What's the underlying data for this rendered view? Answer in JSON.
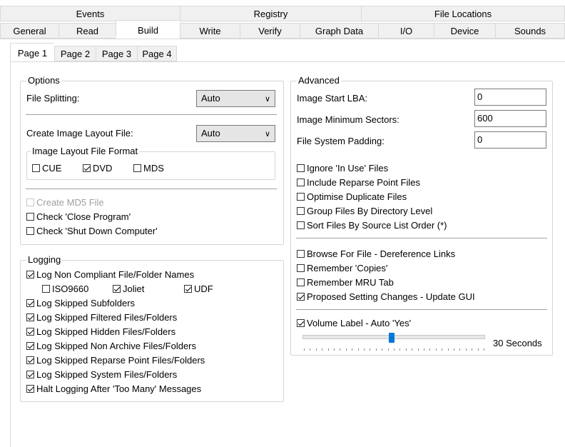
{
  "tabs_top": [
    "Events",
    "Registry",
    "File Locations"
  ],
  "tabs_second": [
    "General",
    "Read",
    "Build",
    "Write",
    "Verify",
    "Graph Data",
    "I/O",
    "Device",
    "Sounds"
  ],
  "subtabs": [
    "Page 1",
    "Page 2",
    "Page 3",
    "Page 4"
  ],
  "options": {
    "legend": "Options",
    "file_splitting_label": "File Splitting:",
    "file_splitting_value": "Auto",
    "create_layout_label": "Create Image Layout File:",
    "create_layout_value": "Auto",
    "layout_format_legend": "Image Layout File Format",
    "format_cue": "CUE",
    "format_dvd": "DVD",
    "format_mds": "MDS",
    "create_md5": "Create MD5 File",
    "check_close_program": "Check 'Close Program'",
    "check_shutdown": "Check 'Shut Down Computer'"
  },
  "logging": {
    "legend": "Logging",
    "non_compliant": "Log Non Compliant File/Folder Names",
    "iso9660": "ISO9660",
    "joliet": "Joliet",
    "udf": "UDF",
    "subfolders": "Log Skipped Subfolders",
    "filtered": "Log Skipped Filtered Files/Folders",
    "hidden": "Log Skipped Hidden Files/Folders",
    "non_archive": "Log Skipped Non Archive Files/Folders",
    "reparse": "Log Skipped Reparse Point Files/Folders",
    "system": "Log Skipped System Files/Folders",
    "halt": "Halt Logging After 'Too Many' Messages"
  },
  "advanced": {
    "legend": "Advanced",
    "start_lba_label": "Image Start LBA:",
    "start_lba_value": "0",
    "min_sectors_label": "Image Minimum Sectors:",
    "min_sectors_value": "600",
    "padding_label": "File System Padding:",
    "padding_value": "0",
    "ignore_in_use": "Ignore 'In Use' Files",
    "include_reparse": "Include Reparse Point Files",
    "optimise_duplicate": "Optimise Duplicate Files",
    "group_by_dir": "Group Files By Directory Level",
    "sort_by_source": "Sort Files By Source List Order (*)",
    "browse_deref": "Browse For File - Dereference Links",
    "remember_copies": "Remember 'Copies'",
    "remember_mru": "Remember MRU Tab",
    "proposed_changes": "Proposed Setting Changes - Update GUI",
    "volume_label_auto": "Volume Label - Auto 'Yes'",
    "slider_value_text": "30 Seconds",
    "slider_fraction": 0.49
  },
  "colors": {
    "accent": "#0078d7",
    "tab_bg": "#f0f0f0",
    "border": "#d9d9d9"
  }
}
